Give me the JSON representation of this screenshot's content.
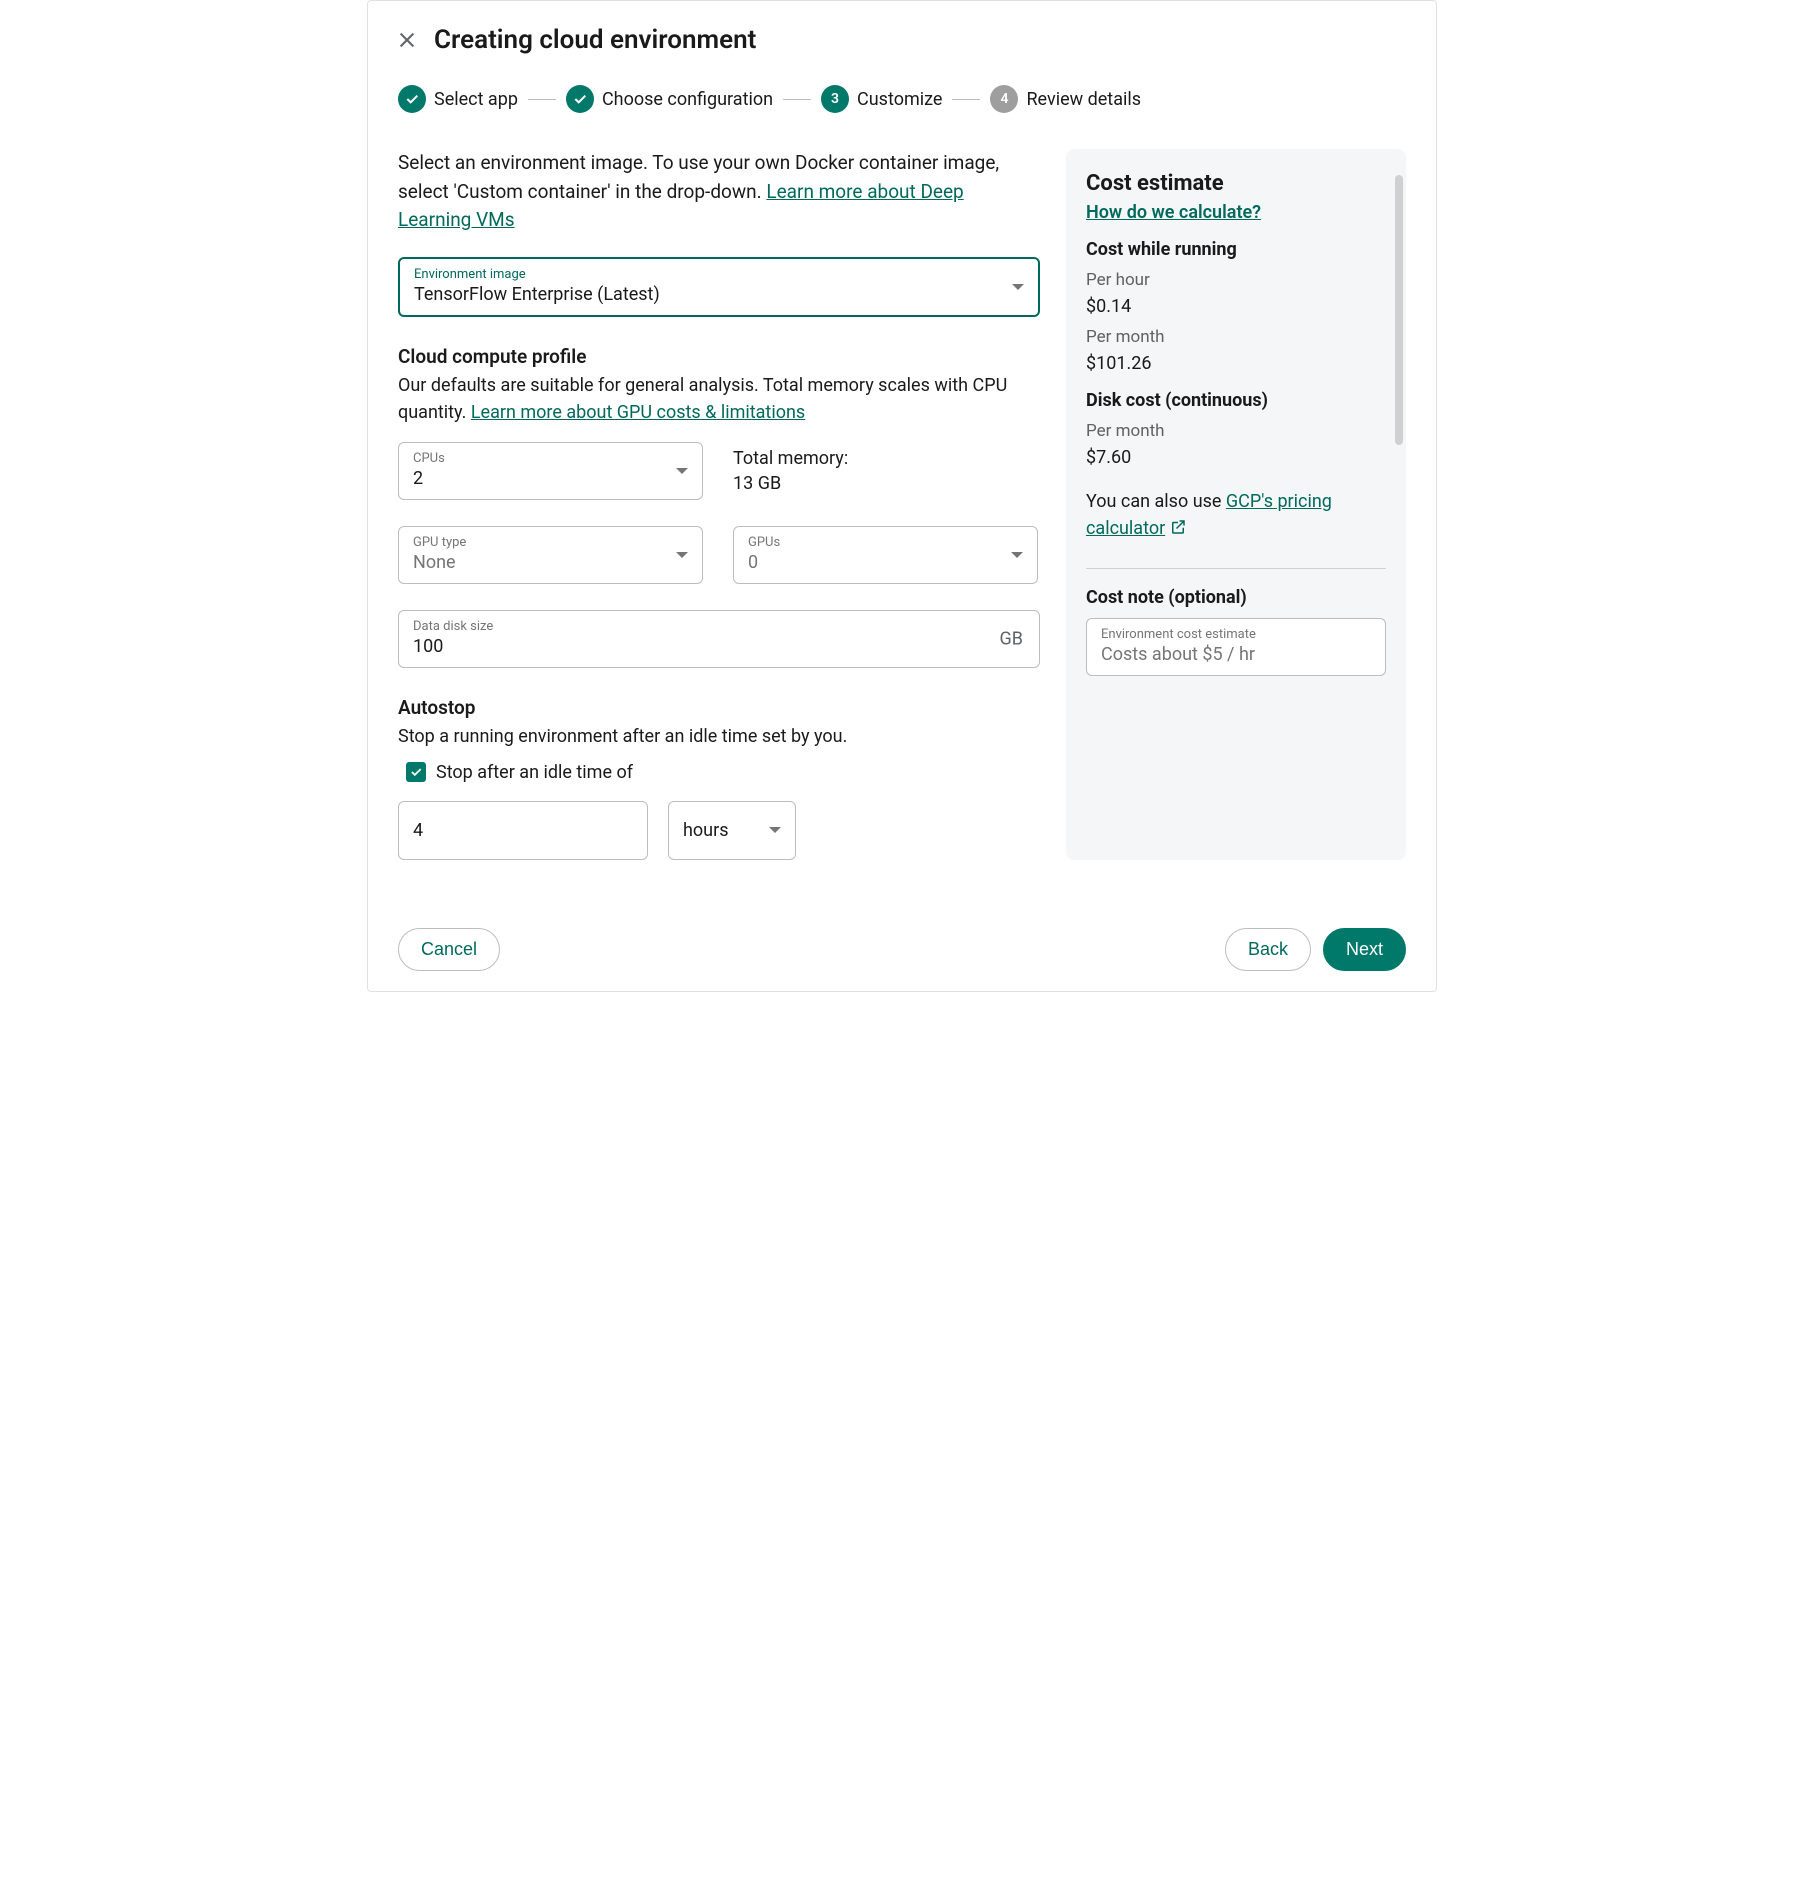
{
  "header": {
    "title": "Creating cloud environment"
  },
  "stepper": {
    "steps": [
      {
        "label": "Select app",
        "state": "done"
      },
      {
        "label": "Choose configuration",
        "state": "done"
      },
      {
        "label": "Customize",
        "state": "active",
        "num": "3"
      },
      {
        "label": "Review details",
        "state": "future",
        "num": "4"
      }
    ]
  },
  "intro": {
    "text_before_link": "Select an environment image. To use your own Docker container image, select 'Custom container' in the drop-down. ",
    "link": "Learn more about Deep Learning VMs"
  },
  "env_image": {
    "label": "Environment image",
    "value": "TensorFlow Enterprise (Latest)"
  },
  "compute": {
    "heading": "Cloud compute profile",
    "desc_before_link": "Our defaults are suitable for general analysis. Total memory scales with CPU quantity. ",
    "link": "Learn more about GPU costs & limitations",
    "cpus_label": "CPUs",
    "cpus_value": "2",
    "memory_label": "Total memory:",
    "memory_value": "13 GB",
    "gpu_type_label": "GPU type",
    "gpu_type_value": "None",
    "gpus_label": "GPUs",
    "gpus_value": "0",
    "disk_label": "Data disk size",
    "disk_value": "100",
    "disk_suffix": "GB"
  },
  "autostop": {
    "heading": "Autostop",
    "desc": "Stop a running environment after an idle time set by you.",
    "checkbox_label": "Stop after an idle time of",
    "checked": true,
    "duration": "4",
    "unit": "hours"
  },
  "cost": {
    "title": "Cost estimate",
    "how_link": "How do we calculate?",
    "running_heading": "Cost while running",
    "per_hour_label": "Per hour",
    "per_hour_value": "$0.14",
    "per_month_label": "Per month",
    "per_month_value": "$101.26",
    "disk_heading": "Disk cost (continuous)",
    "disk_per_month_label": "Per month",
    "disk_per_month_value": "$7.60",
    "also_text": "You can also use ",
    "calc_link": "GCP's pricing calculator",
    "note_heading": "Cost note (optional)",
    "note_label": "Environment cost estimate",
    "note_value": "Costs about $5 / hr"
  },
  "footer": {
    "cancel": "Cancel",
    "back": "Back",
    "next": "Next"
  }
}
